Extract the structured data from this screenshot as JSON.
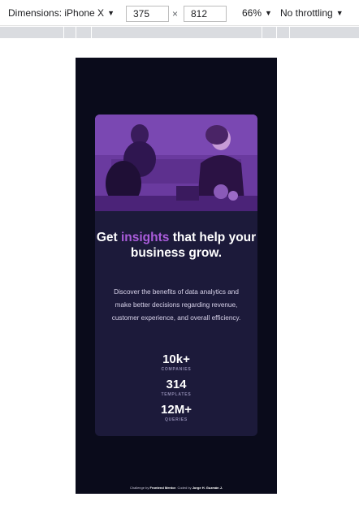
{
  "devtools": {
    "dimensions_label": "Dimensions: iPhone X",
    "width_value": "375",
    "times": "×",
    "height_value": "812",
    "zoom_label": "66%",
    "throttle_label": "No throttling"
  },
  "card": {
    "headline_prefix": "Get ",
    "headline_accent": "insights",
    "headline_suffix": " that help your business grow.",
    "description": "Discover the benefits of data analytics and make better decisions regarding revenue, customer experience, and overall efficiency.",
    "stats": [
      {
        "value": "10k+",
        "label": "COMPANIES"
      },
      {
        "value": "314",
        "label": "TEMPLATES"
      },
      {
        "value": "12M+",
        "label": "QUERIES"
      }
    ]
  },
  "footer": {
    "prefix": "Challenge by ",
    "link1": "Frontend Mentor",
    "middle": ". Coded by ",
    "link2": "Jorge H. Guzmán J.",
    "suffix": ""
  },
  "colors": {
    "page_bg": "#0a0b1b",
    "card_bg": "#1c1a3a",
    "accent": "#aa5cdb",
    "hero_tint": "#6f3ea6"
  }
}
